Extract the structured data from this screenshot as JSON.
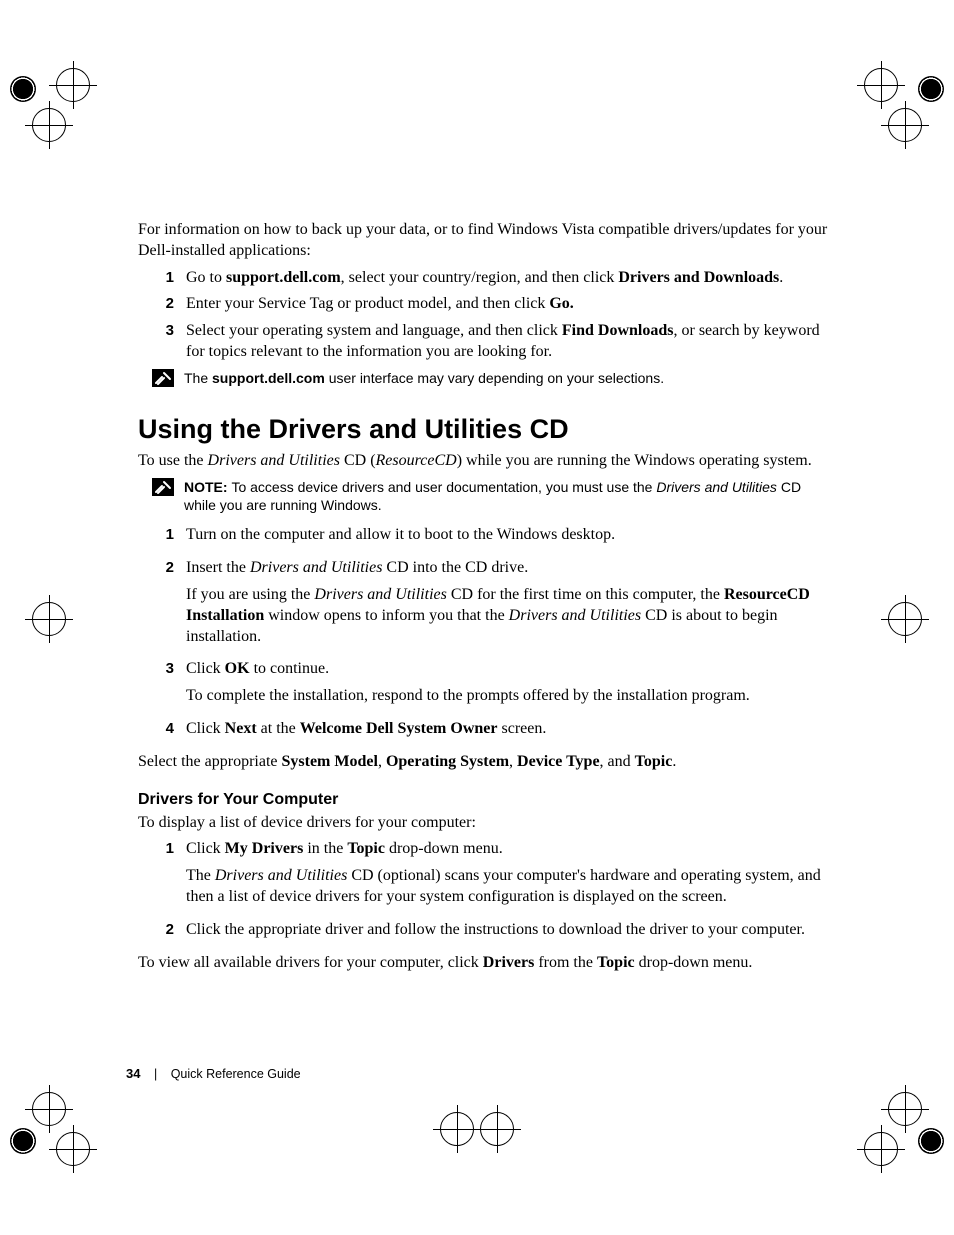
{
  "intro": "For information on how to back up your data, or to find Windows Vista compatible drivers/updates for your Dell-installed applications:",
  "steps_a": [
    {
      "n": "1",
      "parts": [
        {
          "t": "Go to "
        },
        {
          "t": "support.dell.com",
          "b": true
        },
        {
          "t": ", select your country/region, and then click "
        },
        {
          "t": "Drivers and Downloads",
          "b": true
        },
        {
          "t": "."
        }
      ]
    },
    {
      "n": "2",
      "parts": [
        {
          "t": "Enter your Service Tag or product model, and then click "
        },
        {
          "t": "Go.",
          "b": true
        }
      ]
    },
    {
      "n": "3",
      "parts": [
        {
          "t": "Select your operating system and language, and then click "
        },
        {
          "t": "Find Downloads",
          "b": true
        },
        {
          "t": ", or search by keyword for topics relevant to the information you are looking for."
        }
      ]
    }
  ],
  "note1": {
    "parts": [
      {
        "t": "The "
      },
      {
        "t": "support.dell.com",
        "b": true
      },
      {
        "t": " user interface may vary depending on your selections."
      }
    ]
  },
  "h1": "Using the Drivers and Utilities CD",
  "h1_intro": {
    "parts": [
      {
        "t": "To use the "
      },
      {
        "t": "Drivers and Utilities",
        "i": true
      },
      {
        "t": " CD ("
      },
      {
        "t": "ResourceCD",
        "i": true
      },
      {
        "t": ") while you are running the Windows operating system."
      }
    ]
  },
  "note2": {
    "parts": [
      {
        "t": "NOTE: ",
        "b": true
      },
      {
        "t": "To access device drivers and user documentation, you must use the "
      },
      {
        "t": "Drivers and Utilities",
        "sansi": true
      },
      {
        "t": " CD while you are running Windows."
      }
    ]
  },
  "steps_b": [
    {
      "n": "1",
      "paras": [
        {
          "parts": [
            {
              "t": "Turn on the computer and allow it to boot to the Windows desktop."
            }
          ]
        }
      ]
    },
    {
      "n": "2",
      "paras": [
        {
          "parts": [
            {
              "t": "Insert the "
            },
            {
              "t": "Drivers and Utilities",
              "i": true
            },
            {
              "t": " CD into the CD drive."
            }
          ]
        },
        {
          "parts": [
            {
              "t": "If you are using the "
            },
            {
              "t": "Drivers and Utilities",
              "i": true
            },
            {
              "t": " CD for the first time on this computer, the "
            },
            {
              "t": "ResourceCD Installation",
              "b": true
            },
            {
              "t": " window opens to inform you that the "
            },
            {
              "t": "Drivers and Utilities",
              "i": true
            },
            {
              "t": " CD is about to begin installation."
            }
          ]
        }
      ]
    },
    {
      "n": "3",
      "paras": [
        {
          "parts": [
            {
              "t": "Click "
            },
            {
              "t": "OK",
              "b": true
            },
            {
              "t": " to continue."
            }
          ]
        },
        {
          "parts": [
            {
              "t": "To complete the installation, respond to the prompts offered by the installation program."
            }
          ]
        }
      ]
    },
    {
      "n": "4",
      "paras": [
        {
          "parts": [
            {
              "t": "Click "
            },
            {
              "t": "Next",
              "b": true
            },
            {
              "t": " at the "
            },
            {
              "t": "Welcome Dell System Owner",
              "b": true
            },
            {
              "t": " screen."
            }
          ]
        }
      ]
    }
  ],
  "after_b": {
    "parts": [
      {
        "t": "Select the appropriate "
      },
      {
        "t": "System Model",
        "b": true
      },
      {
        "t": ", "
      },
      {
        "t": "Operating System",
        "b": true
      },
      {
        "t": ", "
      },
      {
        "t": "Device Type",
        "b": true
      },
      {
        "t": ", and "
      },
      {
        "t": "Topic",
        "b": true
      },
      {
        "t": "."
      }
    ]
  },
  "h2": "Drivers for Your Computer",
  "h2_intro": "To display a list of device drivers for your computer:",
  "steps_c": [
    {
      "n": "1",
      "paras": [
        {
          "parts": [
            {
              "t": "Click "
            },
            {
              "t": "My Drivers",
              "b": true
            },
            {
              "t": " in the "
            },
            {
              "t": "Topic",
              "b": true
            },
            {
              "t": " drop-down menu."
            }
          ]
        },
        {
          "parts": [
            {
              "t": "The "
            },
            {
              "t": "Drivers and Utilities",
              "i": true
            },
            {
              "t": " CD (optional) scans your computer's hardware and operating system, and then a list of device drivers for your system configuration is displayed on the screen."
            }
          ]
        }
      ]
    },
    {
      "n": "2",
      "paras": [
        {
          "parts": [
            {
              "t": "Click the appropriate driver and follow the instructions to download the driver to your computer."
            }
          ]
        }
      ]
    }
  ],
  "after_c": {
    "parts": [
      {
        "t": "To view all available drivers for your computer, click "
      },
      {
        "t": "Drivers",
        "b": true
      },
      {
        "t": " from the "
      },
      {
        "t": "Topic",
        "b": true
      },
      {
        "t": " drop-down menu."
      }
    ]
  },
  "footer": {
    "page": "34",
    "title": "Quick Reference Guide"
  }
}
